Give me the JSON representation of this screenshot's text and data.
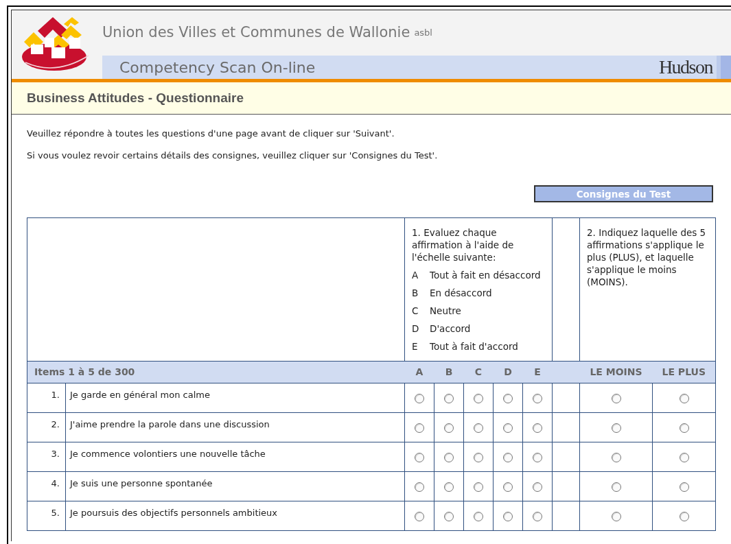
{
  "header": {
    "organization": "Union des Villes et Communes de Wallonie",
    "organization_suffix": "asbl",
    "app_title": "Competency Scan On-line",
    "partner": "Hudson"
  },
  "page_title": "Business Attitudes - Questionnaire",
  "instructions": [
    "Veuillez répondre à toutes les questions d'une page avant de cliquer sur 'Suivant'.",
    "Si vous voulez revoir certains détails des consignes, veuillez cliquer sur 'Consignes du Test'."
  ],
  "instructions_button": "Consignes du Test",
  "scale": {
    "intro": "1. Evaluez chaque affirmation à l'aide de l'échelle suivante:",
    "options": [
      {
        "letter": "A",
        "label": "Tout à fait en désaccord"
      },
      {
        "letter": "B",
        "label": "En désaccord"
      },
      {
        "letter": "C",
        "label": "Neutre"
      },
      {
        "letter": "D",
        "label": "D'accord"
      },
      {
        "letter": "E",
        "label": "Tout à fait d'accord"
      }
    ]
  },
  "ranking_intro": "2. Indiquez laquelle des 5 affirmations s'applique le plus (PLUS), et laquelle s'applique le moins (MOINS).",
  "items_label": "Items 1 à 5 de 300",
  "columns": [
    "A",
    "B",
    "C",
    "D",
    "E"
  ],
  "least_label": "LE MOINS",
  "most_label": "LE PLUS",
  "rows": [
    {
      "number": "1.",
      "text": "Je garde en général mon calme",
      "rating": [
        {
          "selected": false
        },
        {
          "selected": false
        },
        {
          "selected": false
        },
        {
          "selected": false
        },
        {
          "selected": false
        }
      ],
      "least": {
        "selected": false
      },
      "most": {
        "selected": false
      }
    },
    {
      "number": "2.",
      "text": "J'aime prendre la parole dans une discussion",
      "rating": [
        {
          "selected": false
        },
        {
          "selected": false
        },
        {
          "selected": false
        },
        {
          "selected": false
        },
        {
          "selected": false
        }
      ],
      "least": {
        "selected": false
      },
      "most": {
        "selected": false
      }
    },
    {
      "number": "3.",
      "text": "Je commence volontiers une nouvelle tâche",
      "rating": [
        {
          "selected": false
        },
        {
          "selected": false
        },
        {
          "selected": false
        },
        {
          "selected": false
        },
        {
          "selected": false
        }
      ],
      "least": {
        "selected": false
      },
      "most": {
        "selected": false
      }
    },
    {
      "number": "4.",
      "text": "Je suis une personne spontanée",
      "rating": [
        {
          "selected": false
        },
        {
          "selected": false
        },
        {
          "selected": false
        },
        {
          "selected": false
        },
        {
          "selected": false
        }
      ],
      "least": {
        "selected": false
      },
      "most": {
        "selected": false
      }
    },
    {
      "number": "5.",
      "text": "Je poursuis des objectifs personnels ambitieux",
      "rating": [
        {
          "selected": false
        },
        {
          "selected": false
        },
        {
          "selected": false
        },
        {
          "selected": false
        },
        {
          "selected": false
        }
      ],
      "least": {
        "selected": false
      },
      "most": {
        "selected": false
      }
    }
  ]
}
